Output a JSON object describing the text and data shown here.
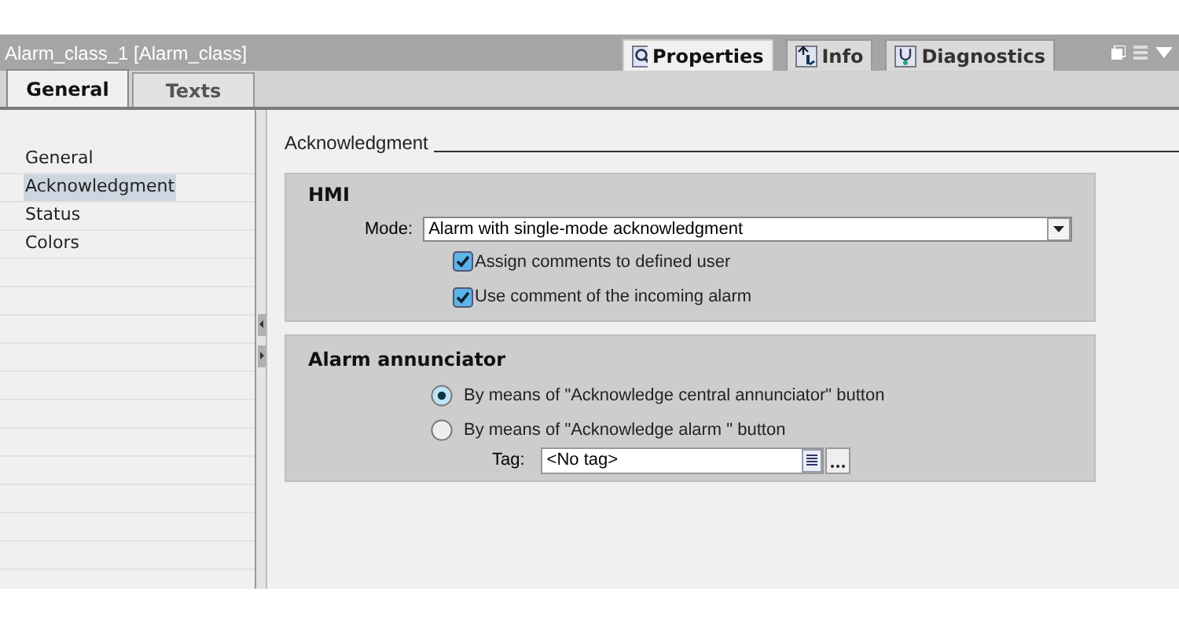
{
  "window": {
    "title": "Alarm_class_1 [Alarm_class]"
  },
  "inspector_tabs": [
    {
      "label": "Properties",
      "selected": true
    },
    {
      "label": "Info",
      "selected": false
    },
    {
      "label": "Diagnostics",
      "selected": false
    }
  ],
  "tabs": [
    {
      "label": "General",
      "selected": true
    },
    {
      "label": "Texts",
      "selected": false
    }
  ],
  "sidebar": {
    "items": [
      {
        "label": "General",
        "selected": false
      },
      {
        "label": "Acknowledgment",
        "selected": true
      },
      {
        "label": "Status",
        "selected": false
      },
      {
        "label": "Colors",
        "selected": false
      }
    ]
  },
  "section_title": "Acknowledgment",
  "hmi": {
    "title": "HMI",
    "mode_label": "Mode:",
    "mode_value": "Alarm with single-mode acknowledgment",
    "options": [
      {
        "label": "Assign comments to defined user",
        "checked": true
      },
      {
        "label": "Use comment of the incoming alarm",
        "checked": true
      }
    ]
  },
  "annunciator": {
    "title": "Alarm annunciator",
    "options": [
      {
        "label": "By means of \"Acknowledge central annunciator\" button",
        "selected": true
      },
      {
        "label": "By means of \"Acknowledge alarm \" button",
        "selected": false
      }
    ],
    "tag_label": "Tag:",
    "tag_value": "<No tag>"
  }
}
